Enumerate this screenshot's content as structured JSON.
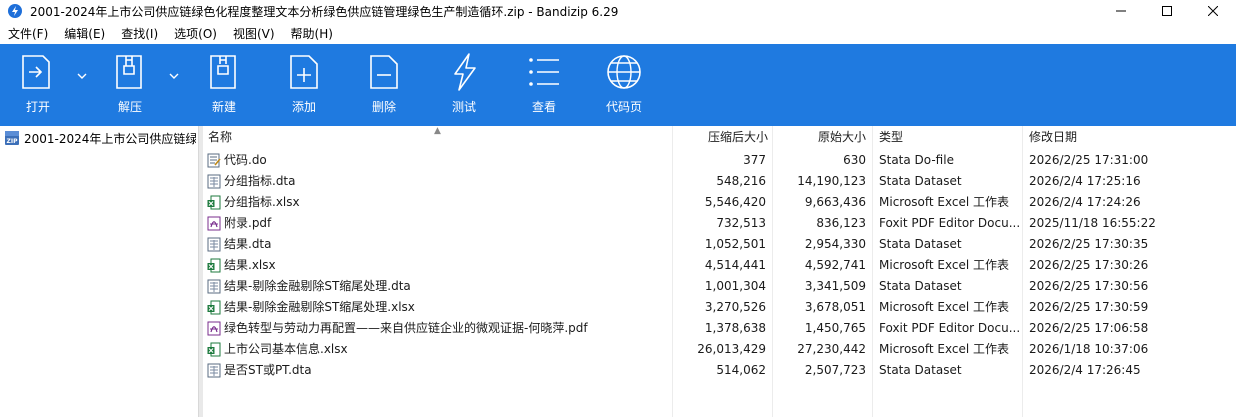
{
  "window": {
    "title": "2001-2024年上市公司供应链绿色化程度整理文本分析绿色供应链管理绿色生产制造循环.zip - Bandizip 6.29"
  },
  "menu": [
    "文件(F)",
    "编辑(E)",
    "查找(I)",
    "选项(O)",
    "视图(V)",
    "帮助(H)"
  ],
  "toolbar": {
    "open": "打开",
    "extract": "解压",
    "new": "新建",
    "add": "添加",
    "delete": "删除",
    "test": "测试",
    "view": "查看",
    "codepage": "代码页"
  },
  "tree": {
    "root_label": "2001-2024年上市公司供应链绿"
  },
  "columns": {
    "name": "名称",
    "packed": "压缩后大小",
    "size": "原始大小",
    "type": "类型",
    "modified": "修改日期"
  },
  "files": [
    {
      "icon": "stata-do-icon",
      "name": "代码.do",
      "packed": "377",
      "size": "630",
      "type": "Stata Do-file",
      "modified": "2026/2/25 17:31:00"
    },
    {
      "icon": "dta-file-icon",
      "name": "分组指标.dta",
      "packed": "548,216",
      "size": "14,190,123",
      "type": "Stata Dataset",
      "modified": "2026/2/4 17:25:16"
    },
    {
      "icon": "excel-file-icon",
      "name": "分组指标.xlsx",
      "packed": "5,546,420",
      "size": "9,663,436",
      "type": "Microsoft Excel 工作表",
      "modified": "2026/2/4 17:24:26"
    },
    {
      "icon": "pdf-file-icon",
      "name": "附录.pdf",
      "packed": "732,513",
      "size": "836,123",
      "type": "Foxit PDF Editor Docu...",
      "modified": "2025/11/18 16:55:22"
    },
    {
      "icon": "dta-file-icon",
      "name": "结果.dta",
      "packed": "1,052,501",
      "size": "2,954,330",
      "type": "Stata Dataset",
      "modified": "2026/2/25 17:30:35"
    },
    {
      "icon": "excel-file-icon",
      "name": "结果.xlsx",
      "packed": "4,514,441",
      "size": "4,592,741",
      "type": "Microsoft Excel 工作表",
      "modified": "2026/2/25 17:30:26"
    },
    {
      "icon": "dta-file-icon",
      "name": "结果-剔除金融剔除ST缩尾处理.dta",
      "packed": "1,001,304",
      "size": "3,341,509",
      "type": "Stata Dataset",
      "modified": "2026/2/25 17:30:56"
    },
    {
      "icon": "excel-file-icon",
      "name": "结果-剔除金融剔除ST缩尾处理.xlsx",
      "packed": "3,270,526",
      "size": "3,678,051",
      "type": "Microsoft Excel 工作表",
      "modified": "2026/2/25 17:30:59"
    },
    {
      "icon": "pdf-file-icon",
      "name": "绿色转型与劳动力再配置——来自供应链企业的微观证据-何晓萍.pdf",
      "packed": "1,378,638",
      "size": "1,450,765",
      "type": "Foxit PDF Editor Docu...",
      "modified": "2026/2/25 17:06:58"
    },
    {
      "icon": "excel-file-icon",
      "name": "上市公司基本信息.xlsx",
      "packed": "26,013,429",
      "size": "27,230,442",
      "type": "Microsoft Excel 工作表",
      "modified": "2026/1/18 10:37:06"
    },
    {
      "icon": "dta-file-icon",
      "name": "是否ST或PT.dta",
      "packed": "514,062",
      "size": "2,507,723",
      "type": "Stata Dataset",
      "modified": "2026/2/4 17:26:45"
    }
  ],
  "colors": {
    "toolbar_bg": "#1f7ae0",
    "excel_green": "#1d7a3e",
    "pdf_purple": "#7a2e8e"
  }
}
